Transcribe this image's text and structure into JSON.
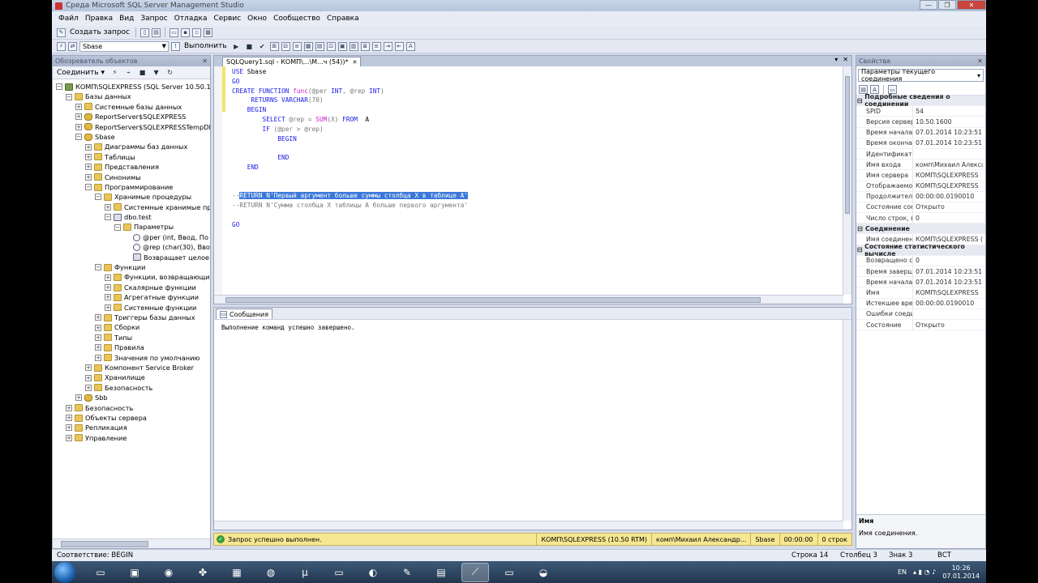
{
  "window": {
    "title": "Среда Microsoft SQL Server Management Studio"
  },
  "menu": [
    "Файл",
    "Правка",
    "Вид",
    "Запрос",
    "Отладка",
    "Сервис",
    "Окно",
    "Сообщество",
    "Справка"
  ],
  "toolbar": {
    "new_query": "Создать запрос",
    "database": "Sbase",
    "execute": "Выполнить"
  },
  "object_explorer": {
    "title": "Обозреватель объектов",
    "connect": "Соединить ▾",
    "tree": [
      {
        "level": 0,
        "exp": "−",
        "icon": "srv",
        "label": "КОМП\\SQLEXPRESS (SQL Server 10.50.1600 -"
      },
      {
        "level": 1,
        "exp": "−",
        "icon": "folder",
        "label": "Базы данных"
      },
      {
        "level": 2,
        "exp": "+",
        "icon": "folder",
        "label": "Системные базы данных"
      },
      {
        "level": 2,
        "exp": "+",
        "icon": "db",
        "label": "ReportServer$SQLEXPRESS"
      },
      {
        "level": 2,
        "exp": "+",
        "icon": "db",
        "label": "ReportServer$SQLEXPRESSTempDB"
      },
      {
        "level": 2,
        "exp": "−",
        "icon": "db",
        "label": "Sbase"
      },
      {
        "level": 3,
        "exp": "+",
        "icon": "folder",
        "label": "Диаграммы баз данных"
      },
      {
        "level": 3,
        "exp": "+",
        "icon": "folder",
        "label": "Таблицы"
      },
      {
        "level": 3,
        "exp": "+",
        "icon": "folder",
        "label": "Представления"
      },
      {
        "level": 3,
        "exp": "+",
        "icon": "folder",
        "label": "Синонимы"
      },
      {
        "level": 3,
        "exp": "−",
        "icon": "folder",
        "label": "Программирование"
      },
      {
        "level": 4,
        "exp": "−",
        "icon": "folder",
        "label": "Хранимые процедуры"
      },
      {
        "level": 5,
        "exp": "+",
        "icon": "folder",
        "label": "Системные хранимые пр"
      },
      {
        "level": 5,
        "exp": "−",
        "icon": "ret",
        "label": "dbo.test"
      },
      {
        "level": 6,
        "exp": "−",
        "icon": "folder",
        "label": "Параметры"
      },
      {
        "level": 7,
        "exp": "",
        "icon": "param",
        "label": "@per (int, Ввод, По"
      },
      {
        "level": 7,
        "exp": "",
        "icon": "param",
        "label": "@rep (char(30), Ввод"
      },
      {
        "level": 7,
        "exp": "",
        "icon": "ret",
        "label": "Возвращает целое"
      },
      {
        "level": 4,
        "exp": "−",
        "icon": "folder",
        "label": "Функции"
      },
      {
        "level": 5,
        "exp": "+",
        "icon": "folder",
        "label": "Функции, возвращающие"
      },
      {
        "level": 5,
        "exp": "+",
        "icon": "folder",
        "label": "Скалярные функции"
      },
      {
        "level": 5,
        "exp": "+",
        "icon": "folder",
        "label": "Агрегатные функции"
      },
      {
        "level": 5,
        "exp": "+",
        "icon": "folder",
        "label": "Системные функции"
      },
      {
        "level": 4,
        "exp": "+",
        "icon": "folder",
        "label": "Триггеры базы данных"
      },
      {
        "level": 4,
        "exp": "+",
        "icon": "folder",
        "label": "Сборки"
      },
      {
        "level": 4,
        "exp": "+",
        "icon": "folder",
        "label": "Типы"
      },
      {
        "level": 4,
        "exp": "+",
        "icon": "folder",
        "label": "Правила"
      },
      {
        "level": 4,
        "exp": "+",
        "icon": "folder",
        "label": "Значения по умолчанию"
      },
      {
        "level": 3,
        "exp": "+",
        "icon": "folder",
        "label": "Компонент Service Broker"
      },
      {
        "level": 3,
        "exp": "+",
        "icon": "folder",
        "label": "Хранилище"
      },
      {
        "level": 3,
        "exp": "+",
        "icon": "folder",
        "label": "Безопасность"
      },
      {
        "level": 2,
        "exp": "+",
        "icon": "db",
        "label": "Sbb"
      },
      {
        "level": 1,
        "exp": "+",
        "icon": "folder",
        "label": "Безопасность"
      },
      {
        "level": 1,
        "exp": "+",
        "icon": "folder",
        "label": "Объекты сервера"
      },
      {
        "level": 1,
        "exp": "+",
        "icon": "folder",
        "label": "Репликация"
      },
      {
        "level": 1,
        "exp": "+",
        "icon": "folder",
        "label": "Управление"
      }
    ]
  },
  "editor": {
    "tab": "SQLQuery1.sql - КОМП\\...\\М...ч (54))*",
    "lines": [
      [
        [
          "kw",
          "USE"
        ],
        [
          "",
          "Sbase"
        ]
      ],
      [
        [
          "kw",
          "GO"
        ]
      ],
      [
        [
          "kw",
          "CREATE FUNCTION"
        ],
        [
          "",
          ""
        ],
        [
          "fn",
          "func"
        ],
        [
          "gr",
          "(@per "
        ],
        [
          "kw",
          "INT"
        ],
        [
          "gr",
          ", @rep "
        ],
        [
          "kw",
          "INT"
        ],
        [
          "gr",
          ")"
        ]
      ],
      [
        [
          "",
          ""
        ],
        [
          "kw",
          "    RETURNS VARCHAR"
        ],
        [
          "gr",
          "(70)"
        ]
      ],
      [
        [
          "kw",
          "    BEGIN"
        ]
      ],
      [
        [
          "kw",
          "        SELECT"
        ],
        [
          "",
          ""
        ],
        [
          "gr",
          "@rep = "
        ],
        [
          "fn",
          "SUM"
        ],
        [
          "gr",
          "(X) "
        ],
        [
          "kw",
          "FROM"
        ],
        [
          "",
          ""
        ],
        [
          "",
          "A"
        ]
      ],
      [
        [
          "kw",
          "        IF"
        ],
        [
          "gr",
          " (@per > @rep)"
        ]
      ],
      [
        [
          "kw",
          "            BEGIN"
        ]
      ],
      [
        [
          "",
          ""
        ]
      ],
      [
        [
          "kw",
          "            END"
        ]
      ],
      [
        [
          "kw",
          "    END"
        ]
      ],
      [
        [
          "",
          ""
        ]
      ],
      [
        [
          "",
          ""
        ]
      ],
      [
        [
          "gr",
          "--"
        ],
        [
          "hl",
          "RETURN N'Первый аргумент больше суммы столбца X в таблице A'"
        ]
      ],
      [
        [
          "gr",
          "--RETURN N'Сумма столбца X таблицы A больше первого аргумента'"
        ]
      ],
      [
        [
          "",
          ""
        ]
      ],
      [
        [
          "kw",
          "GO"
        ]
      ]
    ]
  },
  "messages": {
    "tab": "Сообщения",
    "text": "Выполнение команд успешно завершено."
  },
  "query_status": {
    "message": "Запрос успешно выполнен.",
    "server": "КОМП\\SQLEXPRESS (10.50 RTM)",
    "user": "комп\\Михаил Александр...",
    "database": "Sbase",
    "time": "00:00:00",
    "rows": "0 строк"
  },
  "properties": {
    "title": "Свойства",
    "selector": "Параметры текущего соединения",
    "rows": [
      {
        "cat": true,
        "name": "Подробные сведения о соединении"
      },
      {
        "name": "SPID",
        "value": "54"
      },
      {
        "name": "Версия сервера",
        "value": "10.50.1600"
      },
      {
        "name": "Время начала со",
        "value": "07.01.2014 10:23:51"
      },
      {
        "name": "Время окончания",
        "value": "07.01.2014 10:23:51"
      },
      {
        "name": "Идентификатор т",
        "value": ""
      },
      {
        "name": "Имя входа",
        "value": "комп\\Михаил Алекса"
      },
      {
        "name": "Имя сервера",
        "value": "КОМП\\SQLEXPRESS"
      },
      {
        "name": "Отображаемое и",
        "value": "КОМП\\SQLEXPRESS"
      },
      {
        "name": "Продолжительн",
        "value": "00:00:00.0190010"
      },
      {
        "name": "Состояние соеди",
        "value": "Открыто"
      },
      {
        "name": "Число строк, воз",
        "value": "0"
      },
      {
        "cat": true,
        "name": "Соединение"
      },
      {
        "name": "Имя соединения",
        "value": "КОМП\\SQLEXPRESS ("
      },
      {
        "cat": true,
        "name": "Состояние статистического вычисле"
      },
      {
        "name": "Возвращено стро",
        "value": "0"
      },
      {
        "name": "Время завершен",
        "value": "07.01.2014 10:23:51"
      },
      {
        "name": "Время начала",
        "value": "07.01.2014 10:23:51"
      },
      {
        "name": "Имя",
        "value": "КОМП\\SQLEXPRESS"
      },
      {
        "name": "Истекшее время",
        "value": "00:00:00.0190010"
      },
      {
        "name": "Ошибки соедине",
        "value": ""
      },
      {
        "name": "Состояние",
        "value": "Открыто"
      }
    ],
    "desc_title": "Имя",
    "desc_text": "Имя соединения."
  },
  "statusbar": {
    "left": "Соответствие: BEGIN",
    "line": "Строка 14",
    "col": "Столбец 3",
    "ch": "Знак 3",
    "mode": "ВСТ"
  },
  "tray": {
    "lang": "EN",
    "time": "10:26",
    "date": "07.01.2014"
  }
}
